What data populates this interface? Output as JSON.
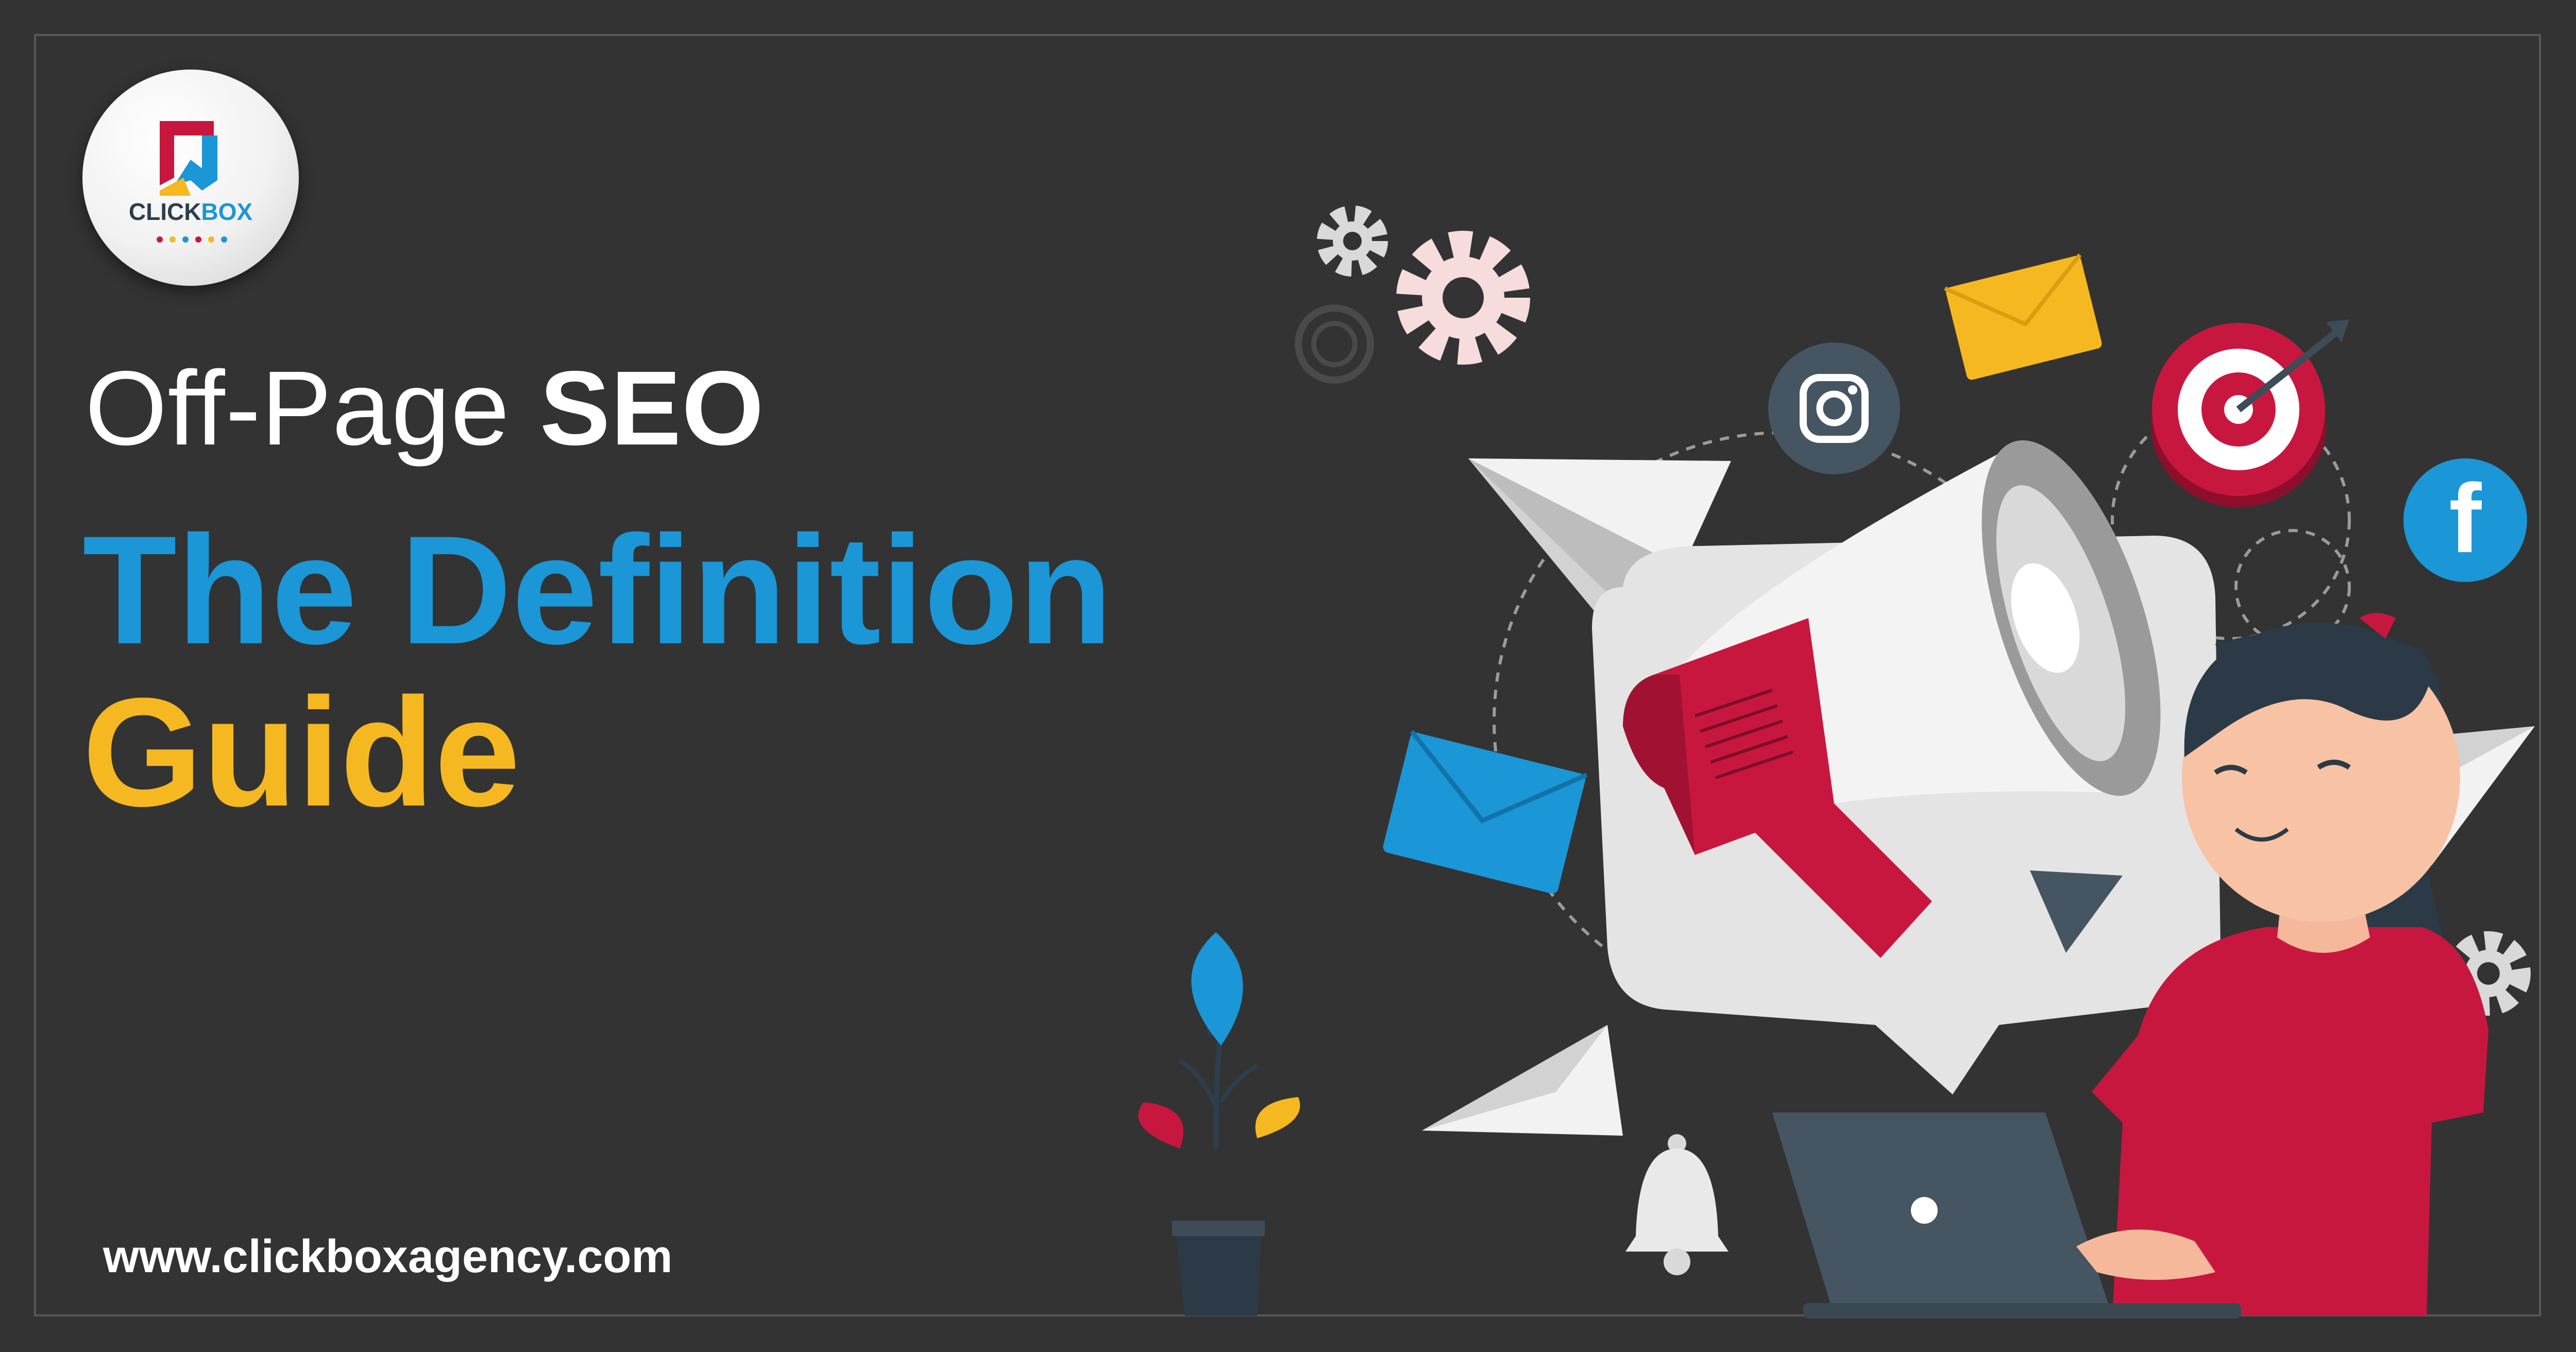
{
  "brand": {
    "name": "CLICKBOX",
    "name_part1": "CLICK",
    "name_part2": "BOX"
  },
  "headline": {
    "line1_regular": "Off-Page ",
    "line1_bold": "SEO",
    "line2": "The Definition",
    "line3": "Guide"
  },
  "website": "www.clickboxagency.com",
  "colors": {
    "background": "#333333",
    "blue": "#1b96d6",
    "yellow": "#f6b820",
    "crimson": "#c8173f",
    "slate": "#455561"
  },
  "illustration": {
    "icons": [
      "instagram-icon",
      "facebook-icon",
      "target-icon",
      "envelope-icon",
      "gear-icon",
      "bell-icon",
      "megaphone-icon",
      "play-icon",
      "paper-plane-icon",
      "laptop-icon",
      "plant-icon"
    ]
  }
}
